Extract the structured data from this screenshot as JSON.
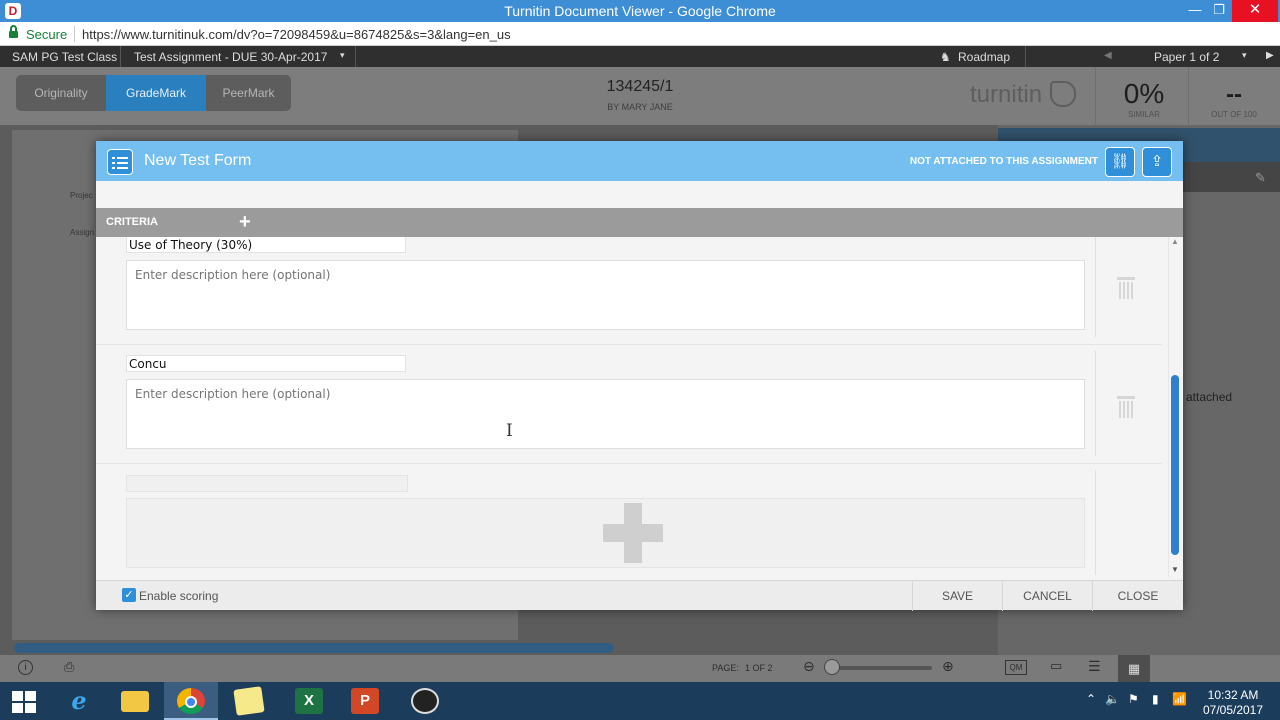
{
  "window": {
    "title": "Turnitin Document Viewer - Google Chrome",
    "app_icon": "turnitin-icon",
    "minimize": "—",
    "maximize": "❐",
    "close": "✕"
  },
  "address": {
    "secure": "Secure",
    "url": "https://www.turnitinuk.com/dv?o=72098459&u=8674825&s=3&lang=en_us"
  },
  "header": {
    "class_name": "SAM PG Test Class",
    "assignment": "Test Assignment - DUE 30-Apr-2017",
    "roadmap": "Roadmap",
    "paper_nav": "Paper 1 of 2",
    "modes": [
      "Originality",
      "GradeMark",
      "PeerMark"
    ],
    "active_mode": "GradeMark",
    "paper_id": "134245/1",
    "author": "BY MARY JANE",
    "brand": "turnitin",
    "similarity": "0%",
    "similarity_label": "SIMILAR",
    "score": "--",
    "score_label": "OUT OF 100"
  },
  "document": {
    "line1": "Projec",
    "line2": "Assign",
    "side_text": "attached"
  },
  "bottom": {
    "page_label": "PAGE:",
    "page_value": "1 OF 2",
    "qm": "QM"
  },
  "modal": {
    "title": "New Test Form",
    "attachment_status": "NOT ATTACHED TO THIS ASSIGNMENT",
    "criteria_label": "CRITERIA",
    "criteria": [
      {
        "name": "Use of Theory (30%)",
        "description": ""
      },
      {
        "name": "Concu",
        "description": ""
      }
    ],
    "description_placeholder": "Enter description here (optional)",
    "enable_scoring": "Enable scoring",
    "enable_scoring_checked": true,
    "save": "SAVE",
    "cancel": "CANCEL",
    "close": "CLOSE"
  },
  "taskbar": {
    "apps": [
      "windows-start",
      "internet-explorer",
      "file-explorer",
      "google-chrome",
      "sticky-notes",
      "excel",
      "powerpoint",
      "obs"
    ],
    "time": "10:32 AM",
    "date": "07/05/2017"
  },
  "colors": {
    "modal_header": "#75bff0",
    "accent_blue": "#2f8fd9",
    "titlebar": "#3e8ed6",
    "taskbar": "#1c3c5c"
  }
}
